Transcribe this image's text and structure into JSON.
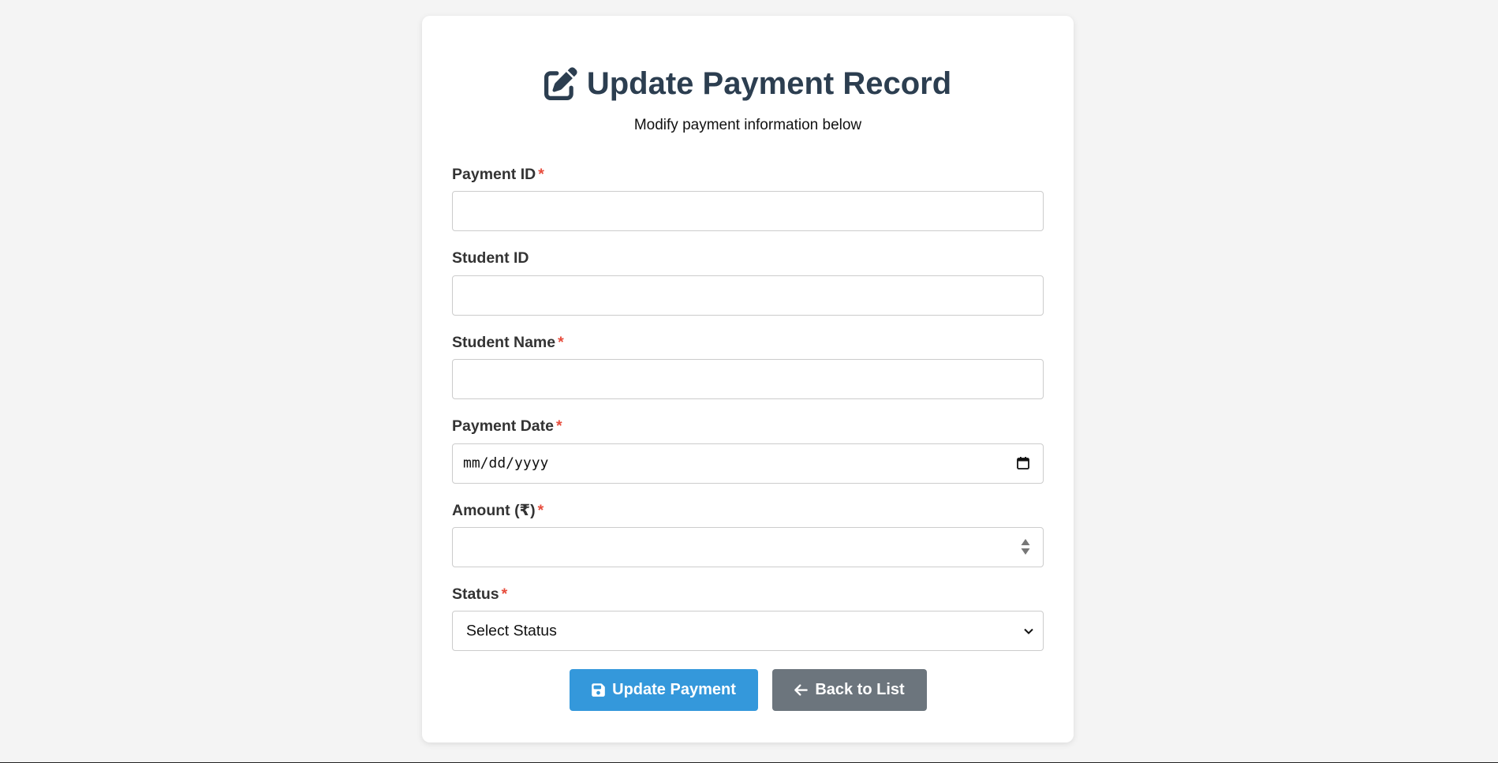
{
  "page": {
    "title": "Update Payment Record",
    "title_icon": "edit-icon",
    "subtitle": "Modify payment information below"
  },
  "form": {
    "required_marker": "*",
    "fields": [
      {
        "label": "Payment ID",
        "required": true,
        "type": "text",
        "value": ""
      },
      {
        "label": "Student ID",
        "required": false,
        "type": "text",
        "value": ""
      },
      {
        "label": "Student Name",
        "required": true,
        "type": "text",
        "value": ""
      },
      {
        "label": "Payment Date",
        "required": true,
        "type": "date",
        "value": "",
        "placeholder": "mm/dd/yyyy"
      },
      {
        "label": "Amount (₹)",
        "required": true,
        "type": "number",
        "value": ""
      },
      {
        "label": "Status",
        "required": true,
        "type": "select",
        "selected": "Select Status"
      }
    ]
  },
  "buttons": {
    "update_label": "Update Payment",
    "update_icon": "save-icon",
    "back_label": "Back to List",
    "back_icon": "arrow-left-icon"
  },
  "colors": {
    "background": "#f4f4f4",
    "title": "#2c3e50",
    "required": "#e74c3c",
    "primary": "#3498db",
    "secondary": "#6c757d"
  }
}
